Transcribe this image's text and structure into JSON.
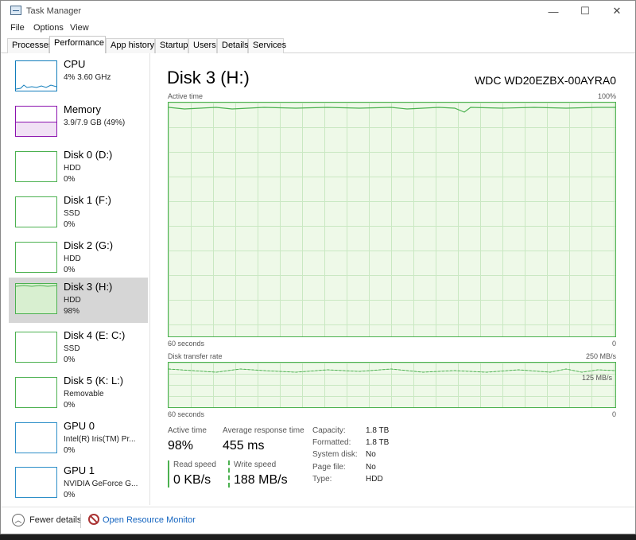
{
  "window": {
    "title": "Task Manager",
    "minimize": "—",
    "maximize": "☐",
    "close": "✕"
  },
  "menu": [
    "File",
    "Options",
    "View"
  ],
  "tabs": [
    "Processes",
    "Performance",
    "App history",
    "Startup",
    "Users",
    "Details",
    "Services"
  ],
  "sidebar": [
    {
      "name": "CPU",
      "sub1": "4% 3.60 GHz",
      "sub2": "",
      "kind": "cpu"
    },
    {
      "name": "Memory",
      "sub1": "3.9/7.9 GB (49%)",
      "sub2": "",
      "kind": "mem"
    },
    {
      "name": "Disk 0 (D:)",
      "sub1": "HDD",
      "sub2": "0%",
      "kind": "disk"
    },
    {
      "name": "Disk 1 (F:)",
      "sub1": "SSD",
      "sub2": "0%",
      "kind": "disk"
    },
    {
      "name": "Disk 2 (G:)",
      "sub1": "HDD",
      "sub2": "0%",
      "kind": "disk"
    },
    {
      "name": "Disk 3 (H:)",
      "sub1": "HDD",
      "sub2": "98%",
      "kind": "disk",
      "selected": true
    },
    {
      "name": "Disk 4 (E: C:)",
      "sub1": "SSD",
      "sub2": "0%",
      "kind": "disk"
    },
    {
      "name": "Disk 5 (K: L:)",
      "sub1": "Removable",
      "sub2": "0%",
      "kind": "disk"
    },
    {
      "name": "GPU 0",
      "sub1": "Intel(R) Iris(TM) Pr...",
      "sub2": "0%",
      "kind": "gpu"
    },
    {
      "name": "GPU 1",
      "sub1": "NVIDIA GeForce G...",
      "sub2": "0%",
      "kind": "gpu"
    }
  ],
  "detail": {
    "title": "Disk 3 (H:)",
    "model": "WDC WD20EZBX-00AYRA0",
    "active_label": "Active time",
    "active_max": "100%",
    "time_label": "60 seconds",
    "zero": "0",
    "transfer_label": "Disk transfer rate",
    "transfer_max": "250 MB/s",
    "transfer_mid": "125 MB/s",
    "stats": {
      "active_time_label": "Active time",
      "active_time": "98%",
      "avg_resp_label": "Average response time",
      "avg_resp": "455 ms",
      "read_label": "Read speed",
      "read": "0 KB/s",
      "write_label": "Write speed",
      "write": "188 MB/s"
    },
    "info": [
      {
        "k": "Capacity:",
        "v": "1.8 TB"
      },
      {
        "k": "Formatted:",
        "v": "1.8 TB"
      },
      {
        "k": "System disk:",
        "v": "No"
      },
      {
        "k": "Page file:",
        "v": "No"
      },
      {
        "k": "Type:",
        "v": "HDD"
      }
    ]
  },
  "footer": {
    "fewer": "Fewer details",
    "monitor": "Open Resource Monitor"
  },
  "colors": {
    "disk": "#4cb150",
    "cpu": "#117dbb",
    "mem": "#8b12ae",
    "link": "#1565c0"
  }
}
